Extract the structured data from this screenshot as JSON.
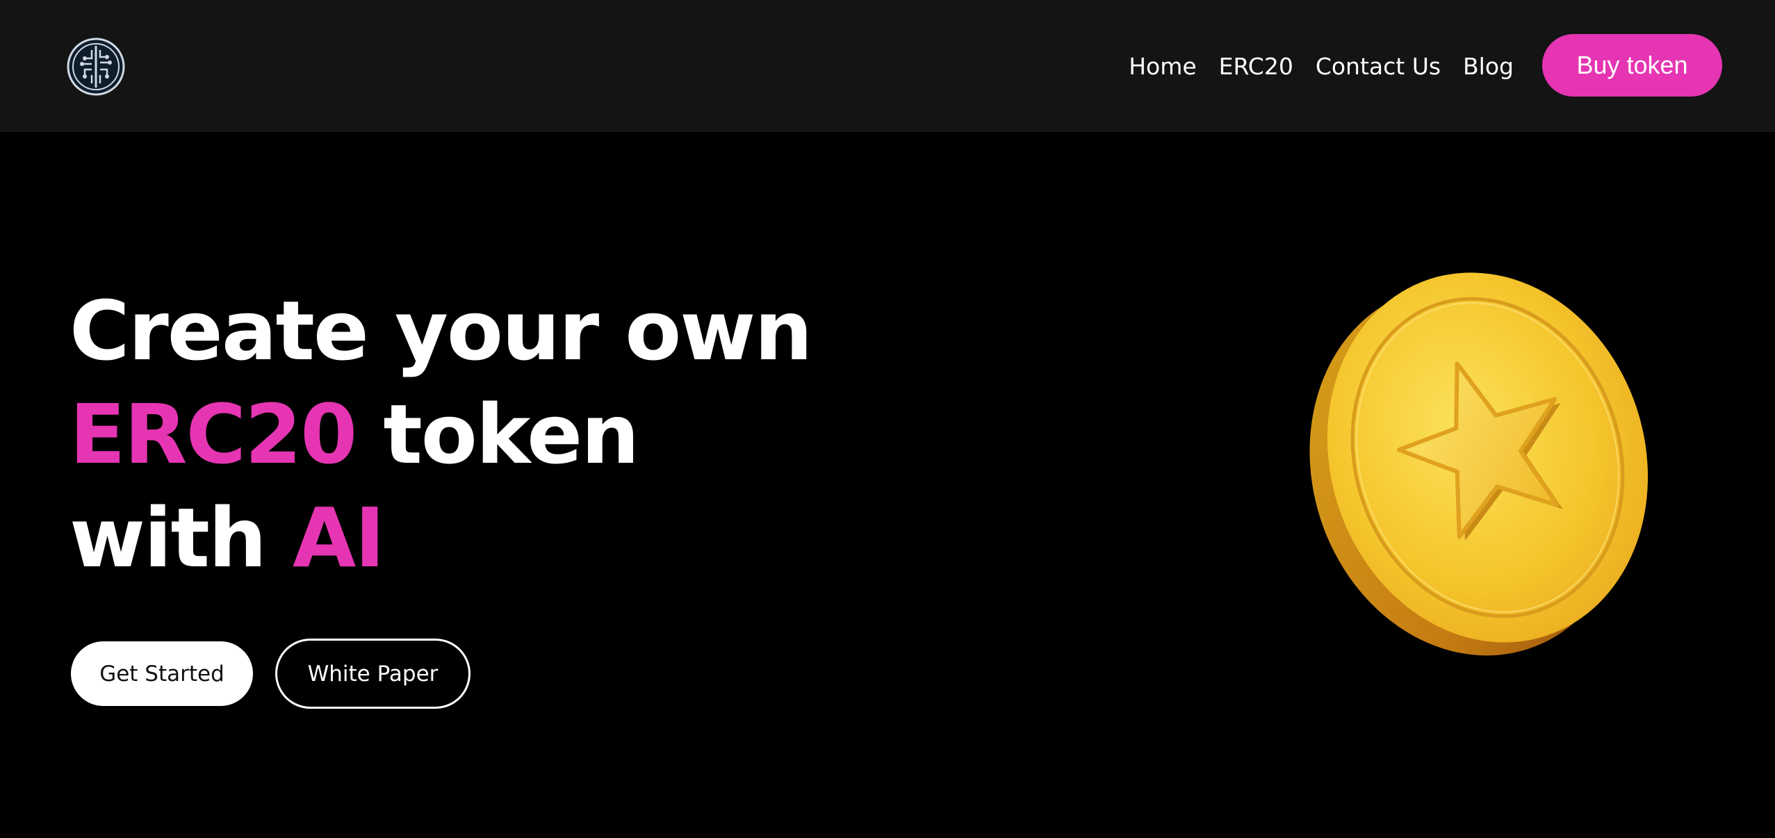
{
  "header": {
    "logo_icon": "circuit-brain-logo",
    "nav": [
      {
        "label": "Home"
      },
      {
        "label": "ERC20"
      },
      {
        "label": "Contact Us"
      },
      {
        "label": "Blog"
      }
    ],
    "cta_label": "Buy token"
  },
  "hero": {
    "line1": "Create your own",
    "line2_accent": "ERC20",
    "line2_rest": " token",
    "line3_start": "with ",
    "line3_accent": "AI",
    "primary_button": "Get Started",
    "secondary_button": "White Paper",
    "illustration_icon": "gold-star-coin"
  },
  "colors": {
    "accent": "#e535b3",
    "header_bg": "#141414",
    "page_bg": "#000000",
    "coin_gold": "#f5c52c"
  }
}
